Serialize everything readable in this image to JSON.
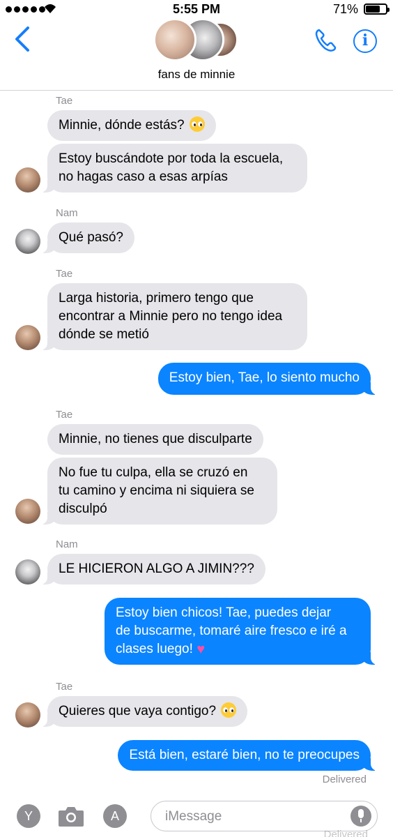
{
  "status_bar": {
    "time": "5:55 PM",
    "battery": "71%",
    "battery_level": 0.71
  },
  "header": {
    "group_name": "fans de minnie"
  },
  "messages": [
    {
      "sender": "Tae",
      "text": "Minnie, dónde estás?",
      "emoji": "pleading-face"
    },
    {
      "text_l1": "Estoy buscándote por toda la escuela,",
      "text_l2": "no hagas caso a esas arpías"
    },
    {
      "sender": "Nam",
      "text": "Qué pasó?"
    },
    {
      "sender": "Tae",
      "text_l1": "Larga historia, primero tengo que",
      "text_l2": "encontrar a Minnie pero no tengo idea",
      "text_l3": "dónde se metió"
    },
    {
      "text": "Estoy bien, Tae, lo siento mucho"
    },
    {
      "sender": "Tae",
      "text": "Minnie, no tienes que disculparte"
    },
    {
      "text_l1": "No fue tu culpa, ella se cruzó en",
      "text_l2": "tu camino y encima ni siquiera se",
      "text_l3": "disculpó"
    },
    {
      "sender": "Nam",
      "text": "LE HICIERON ALGO A JIMIN???"
    },
    {
      "text_l1": "Estoy bien chicos! Tae, puedes dejar",
      "text_l2": "de buscarme, tomaré aire fresco e iré a",
      "text_l3": "clases luego!",
      "emoji": "growing-heart"
    },
    {
      "sender": "Tae",
      "text": "Quieres que vaya contigo?",
      "emoji": "pleading-face"
    },
    {
      "text": "Está bien, estaré bien, no te preocupes"
    }
  ],
  "delivered": "Delivered",
  "input": {
    "placeholder": "iMessage",
    "y_button": "Y",
    "apps_button": "A"
  },
  "colors": {
    "accent": "#147efb",
    "outgoing": "#0b84ff",
    "incoming": "#e5e5ea"
  }
}
